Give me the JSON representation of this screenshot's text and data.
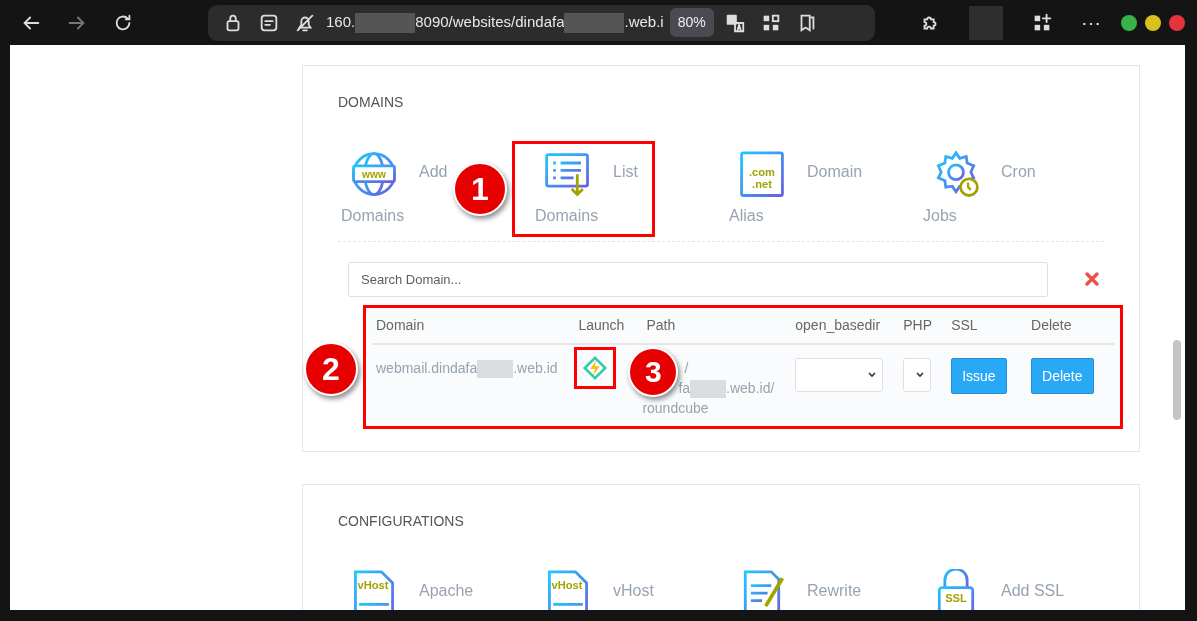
{
  "browser": {
    "address": [
      {
        "kind": "text",
        "text": "160."
      },
      {
        "kind": "redacted"
      },
      {
        "kind": "text",
        "text": "8090/websites/dindafa"
      },
      {
        "kind": "redacted"
      },
      {
        "kind": "text",
        "text": ".web.i"
      }
    ],
    "zoom": "80%",
    "more": "⋯"
  },
  "sections": [
    {
      "title": "DOMAINS",
      "tiles": [
        {
          "kind": "globe",
          "icon_text": [
            "www"
          ],
          "label": "Add",
          "sublabel": "Domains",
          "highlighted": false
        },
        {
          "kind": "list",
          "label": "List",
          "sublabel": "Domains",
          "highlighted": true,
          "marker": "1"
        },
        {
          "kind": "window",
          "icon_text": [
            ".com",
            ".net"
          ],
          "label": "Domain",
          "sublabel": "Alias",
          "highlighted": false
        },
        {
          "kind": "gear",
          "label": "Cron",
          "sublabel": "Jobs",
          "highlighted": false
        }
      ],
      "search": {
        "placeholder": "Search Domain..."
      },
      "table": {
        "highlighted": true,
        "marker": "2",
        "columns": [
          "Domain",
          "Launch",
          "Path",
          "open_basedir",
          "PHP",
          "SSL",
          "Delete"
        ],
        "rows": [
          {
            "domain": [
              {
                "kind": "text",
                "text": "webmail.dindafa"
              },
              {
                "kind": "redacted"
              },
              {
                "kind": "text",
                "text": ".web.id"
              }
            ],
            "launch_highlighted": true,
            "launch_marker": "3",
            "path": [
              [
                {
                  "kind": "text",
                  "text": "/"
                }
              ],
              [
                {
                  "kind": "text",
                  "text": "fa"
                },
                {
                  "kind": "redacted"
                },
                {
                  "kind": "text",
                  "text": ".web.id/"
                }
              ],
              [
                {
                  "kind": "text",
                  "text": "roundcube"
                }
              ]
            ],
            "ssl": "Issue",
            "delete": "Delete"
          }
        ]
      }
    },
    {
      "title": "CONFIGURATIONS",
      "tiles": [
        {
          "kind": "file",
          "icon_text": [
            "vHost"
          ],
          "label": "Apache",
          "highlighted": false
        },
        {
          "kind": "file",
          "icon_text": [
            "vHost"
          ],
          "label": "vHost",
          "highlighted": false
        },
        {
          "kind": "edit",
          "label": "Rewrite",
          "highlighted": false
        },
        {
          "kind": "lock",
          "icon_text": [
            "SSL"
          ],
          "label": "Add SSL",
          "highlighted": false
        }
      ]
    }
  ]
}
